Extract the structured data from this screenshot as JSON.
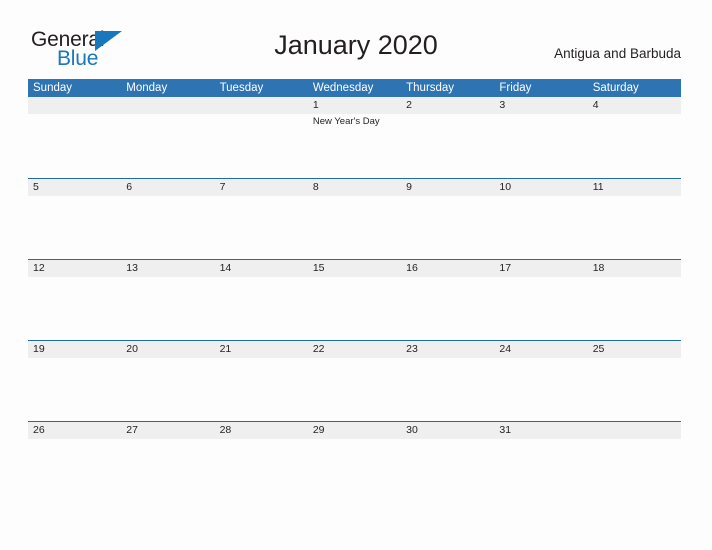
{
  "brand": {
    "name_part1": "General",
    "name_part2": "Blue",
    "accent_color": "#1877bd",
    "triangle_icon": "triangle-icon"
  },
  "header": {
    "title": "January 2020",
    "country": "Antigua and Barbuda"
  },
  "calendar": {
    "header_color": "#2e73b2",
    "band_color": "#efefef",
    "rule_color": "#1f6ca8",
    "weekdays": [
      "Sunday",
      "Monday",
      "Tuesday",
      "Wednesday",
      "Thursday",
      "Friday",
      "Saturday"
    ],
    "weeks": [
      {
        "ruled": false,
        "days": [
          {
            "num": "",
            "event": ""
          },
          {
            "num": "",
            "event": ""
          },
          {
            "num": "",
            "event": ""
          },
          {
            "num": "1",
            "event": "New Year's Day"
          },
          {
            "num": "2",
            "event": ""
          },
          {
            "num": "3",
            "event": ""
          },
          {
            "num": "4",
            "event": ""
          }
        ]
      },
      {
        "ruled": true,
        "days": [
          {
            "num": "5",
            "event": ""
          },
          {
            "num": "6",
            "event": ""
          },
          {
            "num": "7",
            "event": ""
          },
          {
            "num": "8",
            "event": ""
          },
          {
            "num": "9",
            "event": ""
          },
          {
            "num": "10",
            "event": ""
          },
          {
            "num": "11",
            "event": ""
          }
        ]
      },
      {
        "ruled": true,
        "days": [
          {
            "num": "12",
            "event": ""
          },
          {
            "num": "13",
            "event": ""
          },
          {
            "num": "14",
            "event": ""
          },
          {
            "num": "15",
            "event": ""
          },
          {
            "num": "16",
            "event": ""
          },
          {
            "num": "17",
            "event": ""
          },
          {
            "num": "18",
            "event": ""
          }
        ]
      },
      {
        "ruled": true,
        "days": [
          {
            "num": "19",
            "event": ""
          },
          {
            "num": "20",
            "event": ""
          },
          {
            "num": "21",
            "event": ""
          },
          {
            "num": "22",
            "event": ""
          },
          {
            "num": "23",
            "event": ""
          },
          {
            "num": "24",
            "event": ""
          },
          {
            "num": "25",
            "event": ""
          }
        ]
      },
      {
        "ruled": true,
        "days": [
          {
            "num": "26",
            "event": ""
          },
          {
            "num": "27",
            "event": ""
          },
          {
            "num": "28",
            "event": ""
          },
          {
            "num": "29",
            "event": ""
          },
          {
            "num": "30",
            "event": ""
          },
          {
            "num": "31",
            "event": ""
          },
          {
            "num": "",
            "event": ""
          }
        ]
      }
    ]
  }
}
